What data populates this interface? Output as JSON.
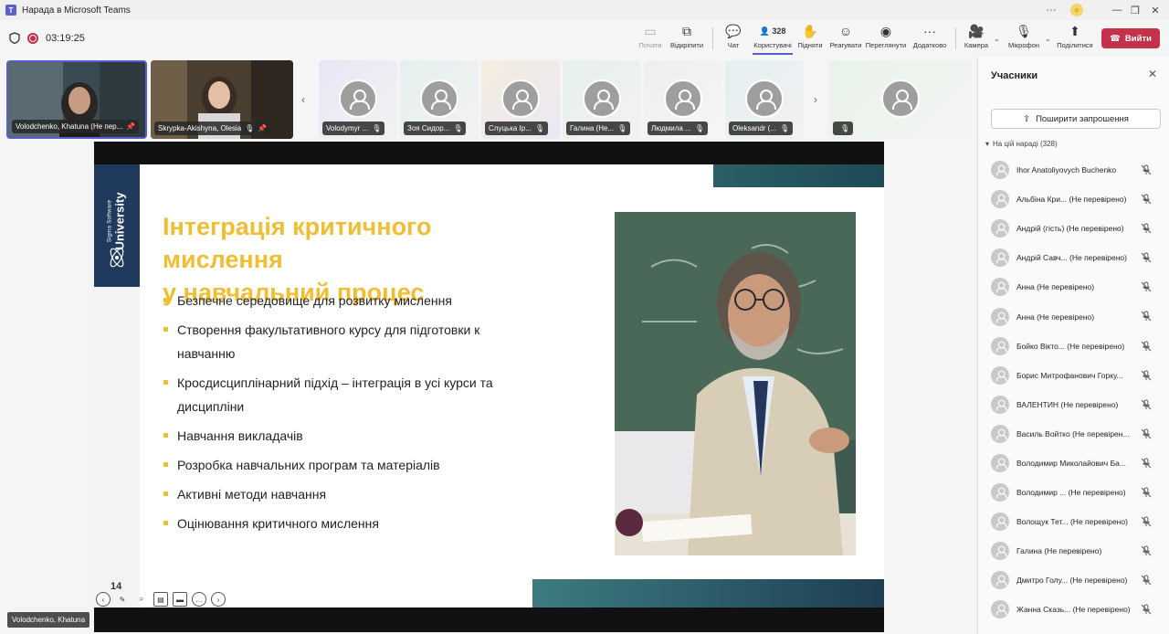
{
  "window": {
    "title": "Нарада в Microsoft Teams",
    "logo": "T"
  },
  "meeting": {
    "timer": "03:19:25"
  },
  "toolbar": {
    "start_label": "Почати",
    "popout_label": "Відкріпити",
    "chat_label": "Чат",
    "people_label": "Користувачі",
    "people_count": "328",
    "raise_label": "Підняти",
    "react_label": "Реагувати",
    "view_label": "Переглянути",
    "more_label": "Додатково",
    "camera_label": "Камера",
    "mic_label": "Мікрофон",
    "share_label": "Поділитися",
    "leave_label": "Вийти"
  },
  "strip": {
    "video_tiles": [
      {
        "name": "Volodchenko, Khatuna (Не пер..."
      },
      {
        "name": "Skrypka-Akishyna, Olesia"
      }
    ],
    "avatar_tiles": [
      {
        "name": "Volodymyr ..."
      },
      {
        "name": "Зоя Сидор..."
      },
      {
        "name": "Слуцька Ір..."
      },
      {
        "name": "Галина (Не..."
      },
      {
        "name": "Людмила ..."
      },
      {
        "name": "Oleksandr (..."
      },
      {
        "name": ""
      }
    ]
  },
  "slide": {
    "brand_small": "Sigma Software",
    "brand_big": "University",
    "title_line1": "Інтеграція критичного мислення",
    "title_line2": "у навчальний процес",
    "bullets": [
      "Безпечне середовище для розвитку мислення",
      "Створення факультативного курсу для підготовки к навчанню",
      "Кросдисциплінарний підхід – інтеграція в усі курси та дисципліни",
      "Навчання викладачів",
      "Розробка навчальних програм та матеріалів",
      "Активні методи навчання",
      "Оцінювання критичного мислення"
    ],
    "page_number": "14"
  },
  "presenter_label": "Volodchenko, Khatuna",
  "panel": {
    "title": "Учасники",
    "invite_label": "Поширити запрошення",
    "section_label": "На цій нараді (328)",
    "participants": [
      "Ihor Anatoliyovych Buchenko",
      "Альбіна Кри...   (Не перевірено)",
      "Андрій (гість) (Не перевірено)",
      "Андрій Савч...   (Не перевірено)",
      "Анна (Не перевірено)",
      "Анна (Не перевірено)",
      "Бойко Вікто...   (Не перевірено)",
      "Борис Митрофанович Горку...",
      "ВАЛЕНТИН (Не перевірено)",
      "Василь Войтко (Не перевірен...",
      "Володимир Миколайович Ба...",
      "Володимир ...   (Не перевірено)",
      "Волощук Тет...   (Не перевірено)",
      "Галина (Не перевірено)",
      "Дмитро Голу...   (Не перевірено)",
      "Жанна Сказь...   (Не перевірено)"
    ]
  },
  "colors": {
    "accent": "#5b5fc7",
    "leave": "#c4314b",
    "slide_title": "#f0be32",
    "brand_blue": "#1f3a5c"
  },
  "icons": {
    "mic_off": "mic-off-icon",
    "person": "person-icon",
    "pin": "pin-icon",
    "shield": "shield-icon",
    "record": "record-icon",
    "phone": "phone-icon"
  }
}
